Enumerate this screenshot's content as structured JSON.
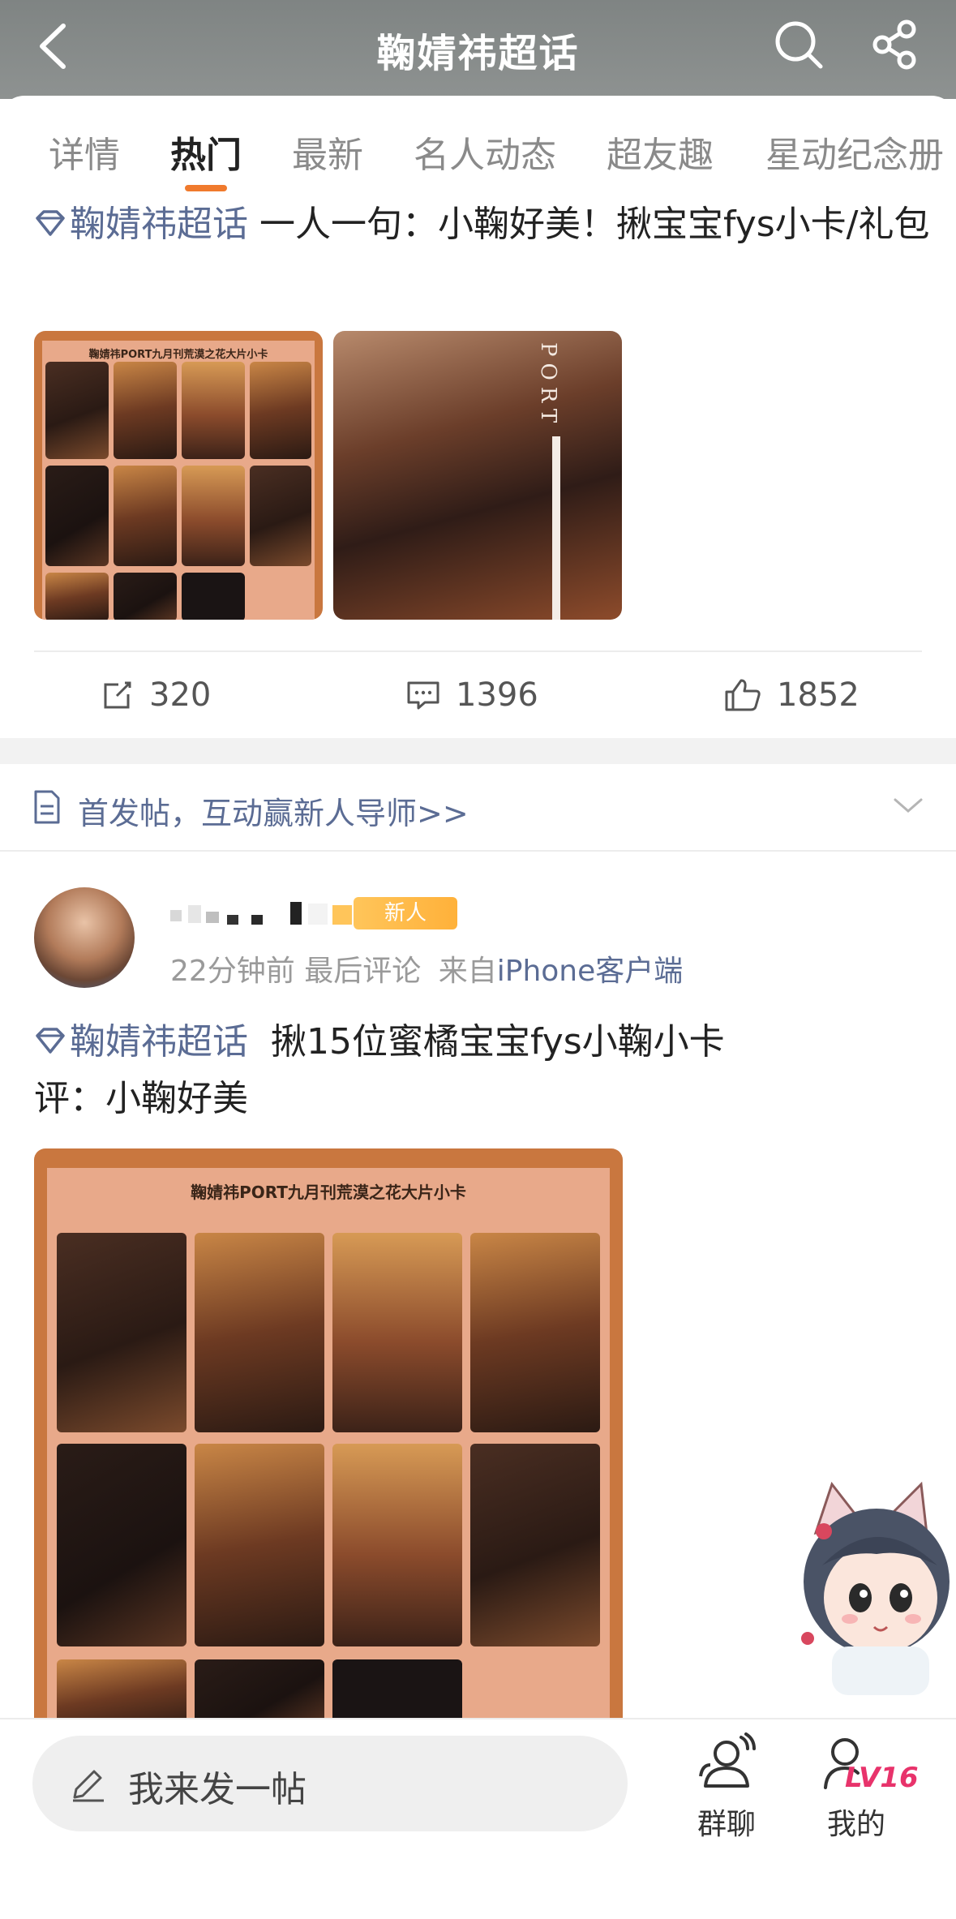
{
  "header": {
    "title": "鞠婧祎超话"
  },
  "tabs": [
    {
      "label": "详情",
      "active": false
    },
    {
      "label": "热门",
      "active": true
    },
    {
      "label": "最新",
      "active": false
    },
    {
      "label": "名人动态",
      "active": false
    },
    {
      "label": "超友趣",
      "active": false
    },
    {
      "label": "星动纪念册",
      "active": false
    }
  ],
  "post1": {
    "topic": "鞠婧祎超话",
    "text": "一人一句：小鞠好美！揪宝宝fys小卡/礼包",
    "image1_title": "鞠婧祎PORT九月刊荒漠之花大片小卡",
    "image2_text": "PORT",
    "repost_count": "320",
    "comment_count": "1396",
    "like_count": "1852"
  },
  "notice": {
    "text": "首发帖，互动赢新人导师>>"
  },
  "post2": {
    "badge": "新人",
    "time": "22分钟前",
    "last_comment": "最后评论",
    "from_prefix": "来自",
    "source": "iPhone客户端",
    "topic": "鞠婧祎超话",
    "text": "揪15位蜜橘宝宝fys小鞠小卡",
    "text2": "评：小鞠好美",
    "image_title": "鞠婧祎PORT九月刊荒漠之花大片小卡"
  },
  "bottom": {
    "compose_placeholder": "我来发一帖",
    "group_chat_label": "群聊",
    "mine_label": "我的",
    "level": "LV16"
  },
  "colors": {
    "header_bg": "#8e9291",
    "accent_orange": "#f07a2d",
    "topic_blue": "#5b6c94",
    "level_pink": "#e8336b"
  }
}
